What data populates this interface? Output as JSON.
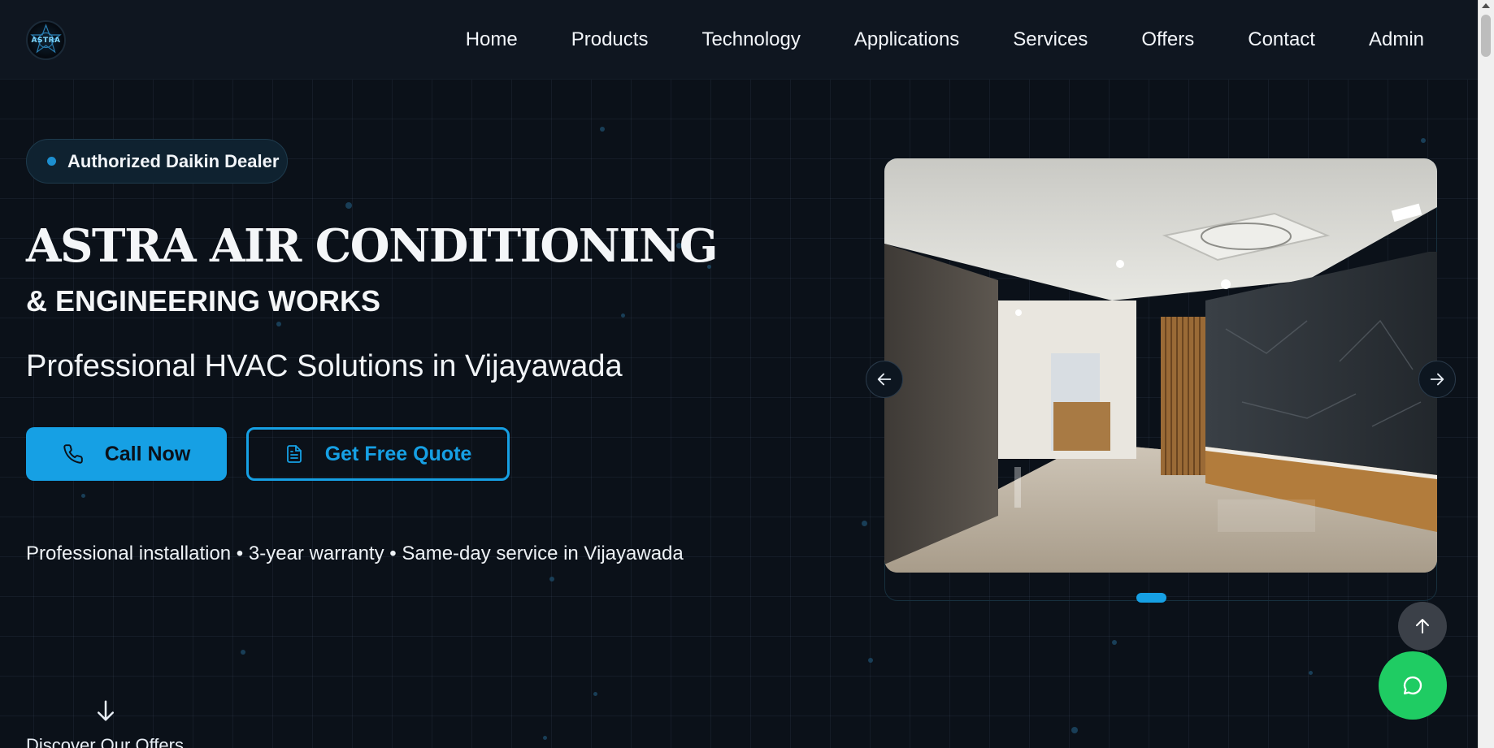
{
  "logo": {
    "text": "ASTRA"
  },
  "nav": {
    "items": [
      {
        "label": "Home"
      },
      {
        "label": "Products"
      },
      {
        "label": "Technology"
      },
      {
        "label": "Applications"
      },
      {
        "label": "Services"
      },
      {
        "label": "Offers"
      },
      {
        "label": "Contact"
      },
      {
        "label": "Admin"
      }
    ]
  },
  "hero": {
    "badge": "Authorized Daikin Dealer",
    "title": "ASTRA AIR CONDITIONING",
    "subtitle": "& ENGINEERING WORKS",
    "tagline": "Professional HVAC Solutions in Vijayawada",
    "call_button": "Call Now",
    "quote_button": "Get Free Quote",
    "features": "Professional installation • 3-year warranty • Same-day service in Vijayawada",
    "discover": "Discover Our Offers"
  },
  "carousel": {
    "slide_count": 1,
    "active_index": 0
  },
  "icons": {
    "call": "phone-icon",
    "quote": "document-icon",
    "prev": "arrow-left-icon",
    "next": "arrow-right-icon",
    "back_top": "arrow-up-icon",
    "chat": "chat-bubble-icon",
    "scroll_down": "arrow-down-icon"
  },
  "colors": {
    "background": "#0b1119",
    "accent": "#16a0e4",
    "chat": "#1fcc63"
  }
}
